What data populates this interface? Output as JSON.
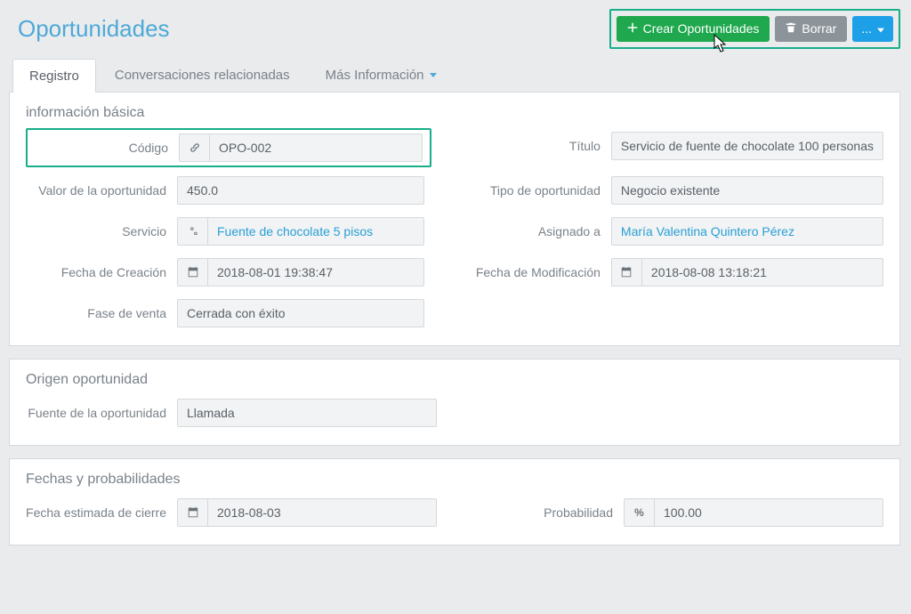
{
  "page": {
    "title": "Oportunidades"
  },
  "actions": {
    "create": "Crear Oportunidades",
    "delete": "Borrar",
    "more": "..."
  },
  "tabs": {
    "register": "Registro",
    "related": "Conversaciones relacionadas",
    "more_info": "Más Información"
  },
  "sections": {
    "basic": "información básica",
    "origin": "Origen oportunidad",
    "dates": "Fechas y probabilidades"
  },
  "labels": {
    "code": "Código",
    "title": "Título",
    "value": "Valor de la oportunidad",
    "type": "Tipo de oportunidad",
    "service": "Servicio",
    "assigned": "Asignado a",
    "created": "Fecha de Creación",
    "modified": "Fecha de Modificación",
    "phase": "Fase de venta",
    "source": "Fuente de la oportunidad",
    "close_date": "Fecha estimada de cierre",
    "probability": "Probabilidad"
  },
  "values": {
    "code": "OPO-002",
    "title": "Servicio de fuente de chocolate 100 personas",
    "value": "450.0",
    "type": "Negocio existente",
    "service": "Fuente de chocolate 5 pisos",
    "assigned": "María Valentina Quintero Pérez",
    "created": "2018-08-01 19:38:47",
    "modified": "2018-08-08 13:18:21",
    "phase": "Cerrada con éxito",
    "source": "Llamada",
    "close_date": "2018-08-03",
    "probability": "100.00",
    "percent_sym": "%"
  }
}
